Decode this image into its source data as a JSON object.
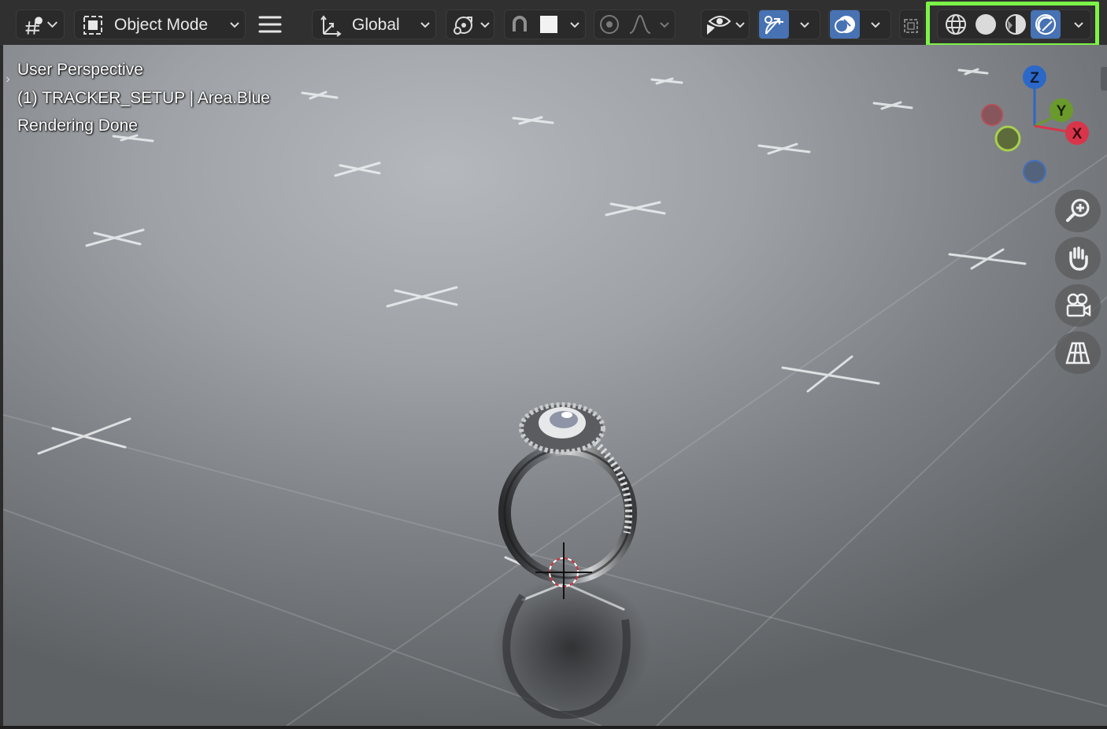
{
  "toolbar": {
    "editor_type_icon": "object-tools-icon",
    "mode": {
      "icon": "object-mode-icon",
      "label": "Object Mode"
    },
    "menu_icon": "hamburger-menu-icon",
    "transform_orientation": {
      "icon": "transform-axes-icon",
      "label": "Global"
    },
    "pivot_icon": "pivot-point-icon",
    "snap": {
      "icon": "snap-magnet-icon",
      "increment_icon": "snap-increment-icon"
    },
    "proportional_edit": {
      "icon": "proportional-edit-icon",
      "falloff_icon": "falloff-curve-icon"
    },
    "visibility_icon": "object-visibility-eye-icon",
    "gizmo_toggle_icon": "gizmo-toggle-icon",
    "overlay_toggle_icon": "overlay-toggle-icon",
    "xray_icon": "xray-toggle-icon",
    "shading": {
      "modes": [
        {
          "name": "wireframe",
          "icon": "wireframe-shading-icon",
          "active": false
        },
        {
          "name": "solid",
          "icon": "solid-shading-icon",
          "active": false
        },
        {
          "name": "material-preview",
          "icon": "material-preview-shading-icon",
          "active": false
        },
        {
          "name": "rendered",
          "icon": "rendered-shading-icon",
          "active": true
        }
      ],
      "highlight_color": "#7cf447"
    }
  },
  "viewport": {
    "overlay_lines": [
      "User Perspective",
      "(1) TRACKER_SETUP | Area.Blue",
      "Rendering Done"
    ],
    "gizmo": {
      "axes": [
        {
          "label": "Z",
          "color": "#2c68c7"
        },
        {
          "label": "Y",
          "color": "#6b9a2c"
        },
        {
          "label": "X",
          "color": "#d9354a"
        }
      ]
    },
    "nav_buttons": [
      {
        "name": "zoom",
        "icon": "zoom-in-icon"
      },
      {
        "name": "pan",
        "icon": "hand-pan-icon"
      },
      {
        "name": "camera",
        "icon": "camera-view-icon"
      },
      {
        "name": "perspective",
        "icon": "perspective-grid-icon"
      }
    ]
  },
  "colors": {
    "accent": "#4772b3",
    "header_bg": "#303030",
    "button_bg": "#2a2a2a"
  }
}
